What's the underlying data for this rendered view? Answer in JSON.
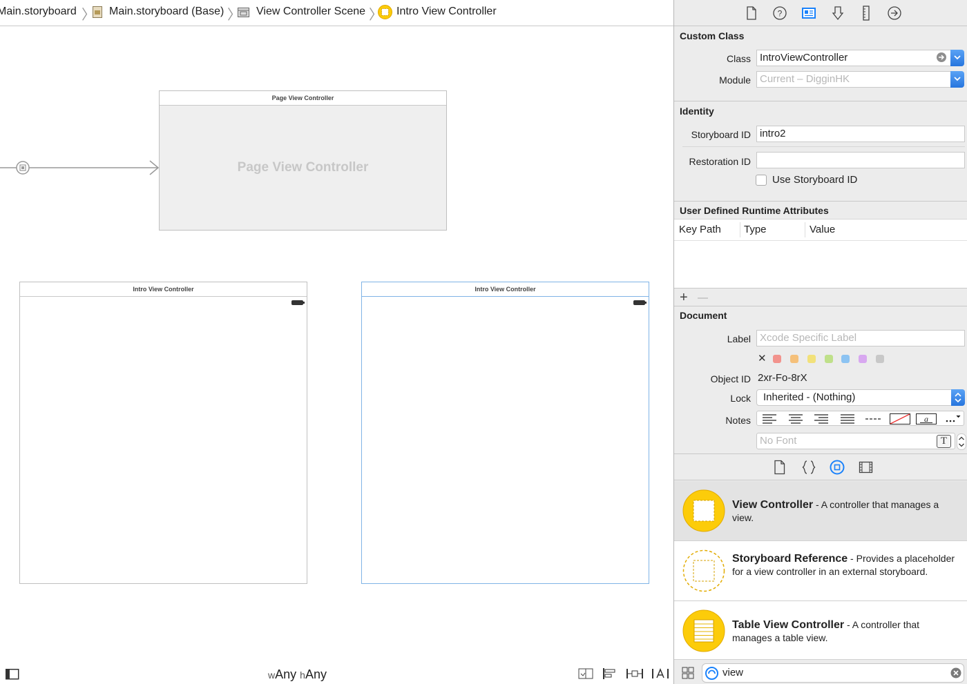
{
  "breadcrumb": {
    "items": [
      {
        "label": "Main.storyboard",
        "icon": "storyboard-file-icon"
      },
      {
        "label": "Main.storyboard (Base)",
        "icon": "storyboard-base-icon"
      },
      {
        "label": "View Controller Scene",
        "icon": "scene-icon"
      },
      {
        "label": "Intro View Controller",
        "icon": "view-controller-icon"
      }
    ]
  },
  "canvas": {
    "page_vc": {
      "title": "Page View Controller",
      "placeholder": "Page View Controller"
    },
    "intro_vc_1": {
      "title": "Intro View Controller"
    },
    "intro_vc_2": {
      "title": "Intro View Controller"
    },
    "size_class": {
      "w_prefix": "w",
      "w_value": "Any",
      "h_prefix": "h",
      "h_value": "Any"
    }
  },
  "inspector": {
    "tabs": [
      "file-inspector-icon",
      "quick-help-icon",
      "identity-inspector-icon",
      "attributes-inspector-icon",
      "size-inspector-icon",
      "connections-inspector-icon"
    ],
    "custom_class": {
      "title": "Custom Class",
      "class_label": "Class",
      "class_value": "IntroViewController",
      "module_label": "Module",
      "module_placeholder": "Current – DigginHK"
    },
    "identity": {
      "title": "Identity",
      "storyboard_id_label": "Storyboard ID",
      "storyboard_id_value": "intro2",
      "restoration_id_label": "Restoration ID",
      "restoration_id_value": "",
      "use_storyboard_id_label": "Use Storyboard ID"
    },
    "runtime_attrs": {
      "title": "User Defined Runtime Attributes",
      "columns": [
        "Key Path",
        "Type",
        "Value"
      ],
      "add": "+",
      "remove": "—"
    },
    "document": {
      "title": "Document",
      "label_label": "Label",
      "label_placeholder": "Xcode Specific Label",
      "clear_mark": "✕",
      "label_colors": [
        "#f2938d",
        "#f5c07a",
        "#f2e17a",
        "#bfe08a",
        "#8cc3f2",
        "#d8a8f0",
        "#c8c8c8"
      ],
      "object_id_label": "Object ID",
      "object_id_value": "2xr-Fo-8rX",
      "lock_label": "Lock",
      "lock_value": "Inherited - (Nothing)",
      "notes_label": "Notes",
      "font_placeholder": "No Font",
      "font_icon_glyph": "T"
    }
  },
  "library": {
    "tabs": [
      "file-template-icon",
      "code-snippet-icon",
      "object-library-icon",
      "media-library-icon"
    ],
    "items": [
      {
        "name": "View Controller",
        "desc": " - A controller that manages a view."
      },
      {
        "name": "Storyboard Reference",
        "desc": " - Provides a placeholder for a view controller in an external storyboard."
      },
      {
        "name": "Table View Controller",
        "desc": " - A controller that manages a table view."
      }
    ],
    "filter_value": "view"
  },
  "colors": {
    "accent": "#1a82fb",
    "library_yellow": "#fccc0a"
  }
}
